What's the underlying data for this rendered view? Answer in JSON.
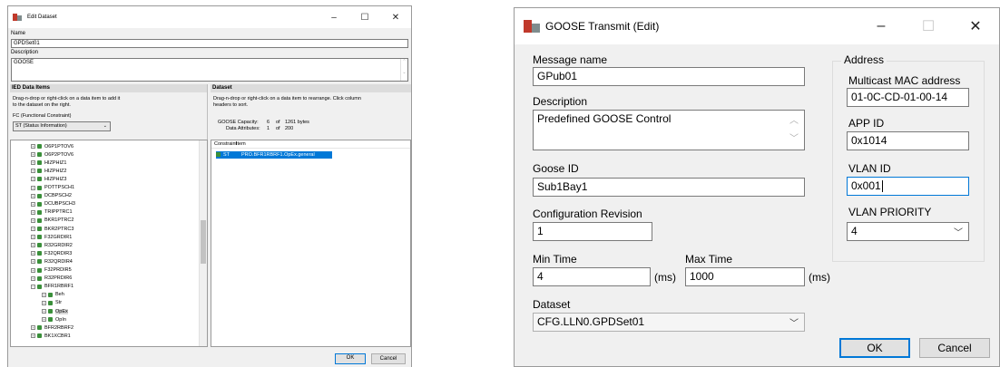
{
  "dataset_dialog": {
    "title": "Edit Dataset",
    "name_label": "Name",
    "name_value": "GPDSet01",
    "description_label": "Description",
    "description_value": "GOOSE",
    "ied_panel": {
      "header": "IED Data Items",
      "instruction": "Drag-n-drop or right-click on a data item to add it to the dataset on the right.",
      "fc_label": "FC (Functional Constraint)",
      "fc_value": "ST (Status Information)",
      "tree_items": [
        "O6P1PTOV6",
        "O6P2PTOV6",
        "HIZPHIZ1",
        "HIZPHIZ2",
        "HIZPHIZ3",
        "POTTPSCH1",
        "DCBPSCH2",
        "DCUBPSCH3",
        "TRIPPTRC1",
        "BKR1PTRC2",
        "BKR2PTRC3",
        "F32GRDIR1",
        "R32GRDIR2",
        "F32QRDIR3",
        "R32QRDIR4",
        "F32PRDIR5",
        "R32PRDIR6",
        "BFR1RBRF1",
        "Beh",
        "Str",
        "OpEx",
        "OpIn",
        "BFR2RBRF2",
        "BK1XCBR1"
      ]
    },
    "dataset_panel": {
      "header": "Dataset",
      "instruction": "Drag-n-drop or right-click on a data item to rearrange. Click column headers to sort.",
      "capacity_label": "GOOSE Capacity:",
      "capacity_value": "6",
      "capacity_of": "of",
      "capacity_max": "1261 bytes",
      "attributes_label": "Data Attributes:",
      "attributes_value": "1",
      "attributes_of": "of",
      "attributes_max": "200",
      "col_constraint": "Constraint",
      "col_item": "Item",
      "row_constraint": "ST",
      "row_item": "PRO.BFR1RBRF1.OpEx.general"
    },
    "ok_label": "OK",
    "cancel_label": "Cancel"
  },
  "goose_dialog": {
    "title": "GOOSE Transmit (Edit)",
    "message_name_label": "Message name",
    "message_name_value": "GPub01",
    "description_label": "Description",
    "description_value": "Predefined GOOSE Control",
    "goose_id_label": "Goose ID",
    "goose_id_value": "Sub1Bay1",
    "config_rev_label": "Configuration Revision",
    "config_rev_value": "1",
    "min_time_label": "Min Time",
    "min_time_value": "4",
    "max_time_label": "Max Time",
    "max_time_value": "1000",
    "ms_unit": "(ms)",
    "dataset_label": "Dataset",
    "dataset_value": "CFG.LLN0.GPDSet01",
    "address_group_label": "Address",
    "mac_label": "Multicast MAC address",
    "mac_value": "01-0C-CD-01-00-14",
    "app_id_label": "APP ID",
    "app_id_value": "0x1014",
    "vlan_id_label": "VLAN ID",
    "vlan_id_value": "0x001",
    "vlan_priority_label": "VLAN PRIORITY",
    "vlan_priority_value": "4",
    "ok_label": "OK",
    "cancel_label": "Cancel"
  },
  "icons": {
    "app": "app-logo-icon",
    "tree_node": "data-node-icon",
    "minimize": "minimize-icon",
    "maximize": "maximize-icon",
    "close": "close-icon"
  },
  "colors": {
    "accent": "#0078d7",
    "selection": "#0078d7",
    "panel_header": "#dcdcdc",
    "node_green": "#3a8f3a",
    "logo_red": "#c0392b"
  }
}
